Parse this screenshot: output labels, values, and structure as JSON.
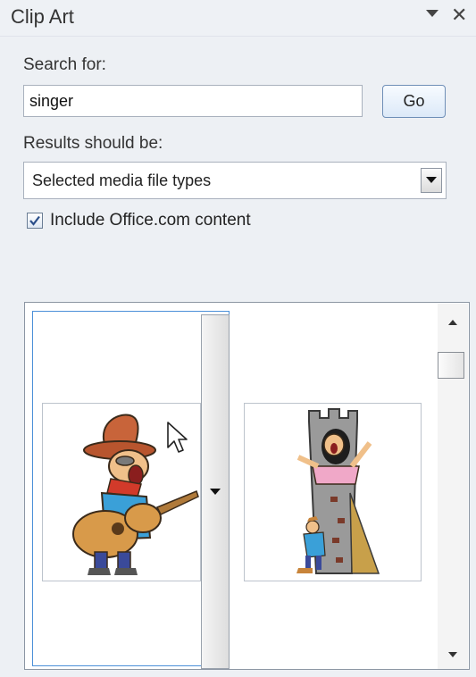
{
  "pane": {
    "title": "Clip Art",
    "options_icon": "triangle-down-icon",
    "close_icon": "close-icon",
    "close_glyph": "✕"
  },
  "search": {
    "label": "Search for:",
    "value": "singer",
    "go_label": "Go"
  },
  "results_filter": {
    "label": "Results should be:",
    "selected": "Selected media file types"
  },
  "include_office": {
    "label": "Include Office.com content",
    "checked": true
  },
  "results": {
    "items": [
      {
        "icon": "cowboy-singer-guitar-clipart",
        "selected": true
      },
      {
        "icon": "tower-singer-clipart",
        "selected": false
      }
    ]
  },
  "colors": {
    "selection_border": "#4a8fd8",
    "go_border": "#6f8fb7"
  }
}
